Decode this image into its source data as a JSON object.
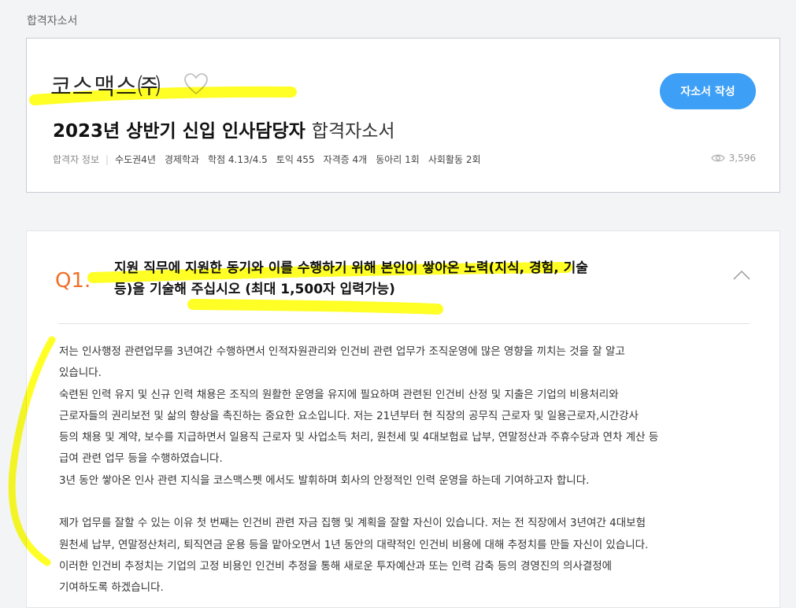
{
  "breadcrumb": "합격자소서",
  "header": {
    "company": "코스맥스㈜",
    "title_bold": "2023년 상반기 신입 인사담당자",
    "title_light": "합격자소서",
    "write_button": "자소서 작성",
    "info_label": "합격자 정보",
    "info_items": [
      "수도권4년",
      "경제학과",
      "학점 4.13/4.5",
      "토익 455",
      "자격증 4개",
      "동아리 1회",
      "사회활동 2회"
    ],
    "views": "3,596"
  },
  "question": {
    "number": "Q1.",
    "text_line1": "지원 직무에 지원한 동기와 이를 수행하기 위해 본인이 쌓아온 노력(지식, 경험, 기술",
    "text_line2": "등)을 기술해 주십시오 (최대 1,500자 입력가능)",
    "answer_lines": [
      "저는 인사행정 관련업무를 3년여간 수행하면서 인적자원관리와 인건비 관련 업무가 조직운영에 많은 영향을 끼치는 것을 잘 알고",
      "있습니다.",
      "숙련된 인력 유지 및 신규 인력 채용은 조직의 원활한 운영을 유지에 필요하며 관련된 인건비 산정 및 지출은 기업의 비용처리와",
      "근로자들의 권리보전 및 삶의 향상을 촉진하는 중요한 요소입니다. 저는 21년부터 현 직장의 공무직 근로자 및 일용근로자,시간강사",
      "등의 채용 및 계약, 보수를 지급하면서 일용직 근로자 및 사업소득 처리, 원천세 및 4대보험료 납부, 연말정산과 주휴수당과 연차 계산 등",
      "급여 관련 업무 등을 수행하였습니다.",
      "3년 동안 쌓아온 인사 관련 지식을 코스맥스펫 에서도 발휘하며 회사의 안정적인 인력 운영을 하는데 기여하고자 합니다.",
      "",
      "제가 업무를 잘할 수 있는 이유 첫 번째는 인건비 관련 자금 집행 및 계획을 잘할 자신이 있습니다. 저는 전 직장에서 3년여간 4대보험",
      "원천세 납부, 연말정산처리, 퇴직연금 운용 등을 맡아오면서 1년 동안의 대략적인 인건비 비용에 대해 추정치를 만들 자신이 있습니다.",
      "이러한 인건비 추정치는 기업의 고정 비용인 인건비 추정을 통해 새로운 투자예산과 또는 인력 감축 등의 경영진의 의사결정에",
      "기여하도록 하겠습니다."
    ]
  },
  "colors": {
    "accent_blue": "#3d9ff5",
    "question_orange": "#f07028",
    "highlighter": "#ffff00"
  }
}
